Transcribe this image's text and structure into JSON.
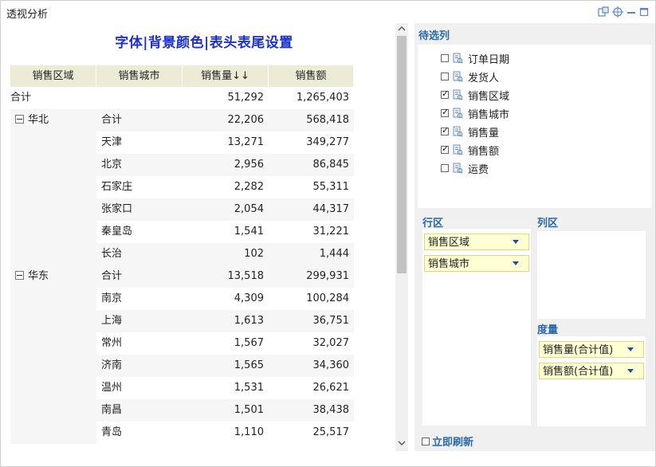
{
  "window": {
    "title": "透视分析"
  },
  "report": {
    "title": "字体|背景颜色|表头表尾设置",
    "headers": [
      "销售区域",
      "销售城市",
      "销售量↓↓",
      "销售额"
    ],
    "grand_total": {
      "label": "合计",
      "qty": "51,292",
      "amount": "1,265,403"
    },
    "groups": [
      {
        "region": "华北",
        "rows": [
          {
            "city": "合计",
            "qty": "22,206",
            "amount": "568,418"
          },
          {
            "city": "天津",
            "qty": "13,271",
            "amount": "349,277"
          },
          {
            "city": "北京",
            "qty": "2,956",
            "amount": "86,845"
          },
          {
            "city": "石家庄",
            "qty": "2,282",
            "amount": "55,311"
          },
          {
            "city": "张家口",
            "qty": "2,054",
            "amount": "44,317"
          },
          {
            "city": "秦皇岛",
            "qty": "1,541",
            "amount": "31,221"
          },
          {
            "city": "长治",
            "qty": "102",
            "amount": "1,444"
          }
        ]
      },
      {
        "region": "华东",
        "rows": [
          {
            "city": "合计",
            "qty": "13,518",
            "amount": "299,931"
          },
          {
            "city": "南京",
            "qty": "4,309",
            "amount": "100,284"
          },
          {
            "city": "上海",
            "qty": "1,613",
            "amount": "36,751"
          },
          {
            "city": "常州",
            "qty": "1,567",
            "amount": "32,027"
          },
          {
            "city": "济南",
            "qty": "1,565",
            "amount": "34,360"
          },
          {
            "city": "温州",
            "qty": "1,531",
            "amount": "26,621"
          },
          {
            "city": "南昌",
            "qty": "1,501",
            "amount": "38,438"
          },
          {
            "city": "青岛",
            "qty": "1,110",
            "amount": "25,517"
          }
        ]
      }
    ]
  },
  "panel": {
    "candidates_label": "待选列",
    "fields": [
      {
        "label": "订单日期",
        "checked": false
      },
      {
        "label": "发货人",
        "checked": false
      },
      {
        "label": "销售区域",
        "checked": true
      },
      {
        "label": "销售城市",
        "checked": true
      },
      {
        "label": "销售量",
        "checked": true
      },
      {
        "label": "销售额",
        "checked": true
      },
      {
        "label": "运费",
        "checked": false
      }
    ],
    "row_zone_label": "行区",
    "row_zone_items": [
      "销售区域",
      "销售城市"
    ],
    "col_zone_label": "列区",
    "measure_label": "度量",
    "measure_items": [
      "销售量(合计值)",
      "销售额(合计值)"
    ],
    "refresh_label": "立即刷新"
  },
  "colors": {
    "title": "#1c2fd1",
    "header_bg": "#ecebd6",
    "chip_bg": "#ffffd4",
    "section_label": "#2b6aa6"
  }
}
